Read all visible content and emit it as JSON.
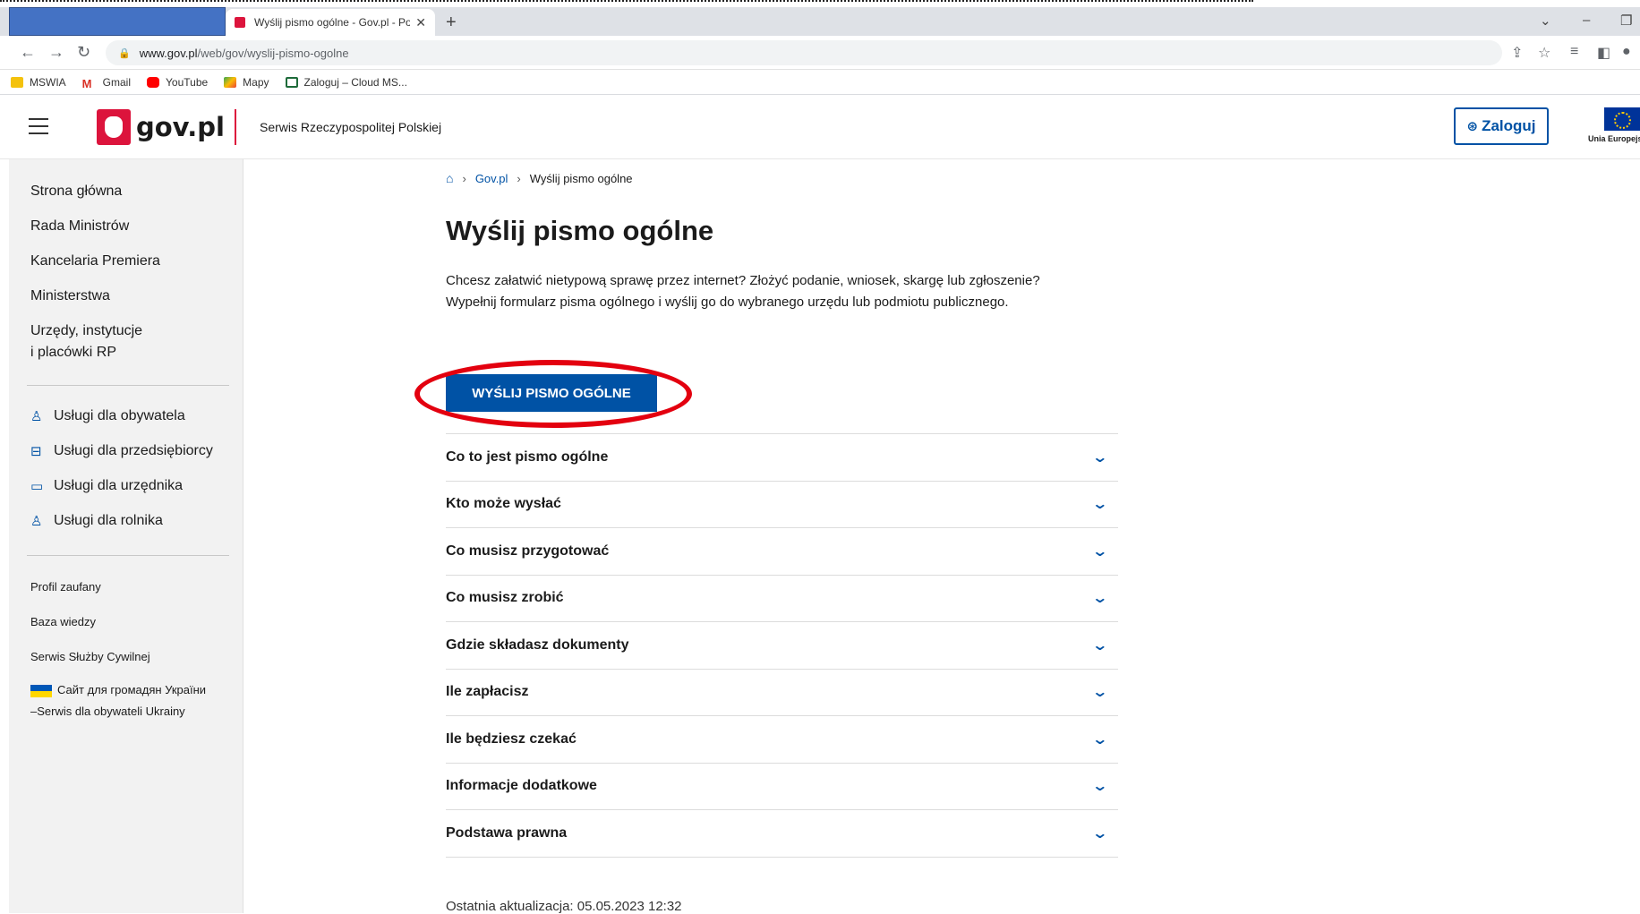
{
  "browser": {
    "tab_title": "Wyślij pismo ogólne - Gov.pl - Po",
    "url_host": "www.gov.pl",
    "url_path": "/web/gov/wyslij-pismo-ogolne",
    "bookmarks": [
      "MSWIA",
      "Gmail",
      "YouTube",
      "Mapy",
      "Zaloguj – Cloud MS..."
    ]
  },
  "header": {
    "logo_text": "gov.pl",
    "tagline": "Serwis Rzeczypospolitej Polskiej",
    "login_label": "Zaloguj",
    "eu_label": "Unia Europejska"
  },
  "sidebar": {
    "main_items": [
      "Strona główna",
      "Rada Ministrów",
      "Kancelaria Premiera",
      "Ministerstwa",
      "Urzędy, instytucje",
      "i placówki RP"
    ],
    "services": [
      "Usługi dla obywatela",
      "Usługi dla przedsiębiorcy",
      "Usługi dla urzędnika",
      "Usługi dla rolnika"
    ],
    "links": [
      "Profil zaufany",
      "Baza wiedzy",
      "Serwis Służby Cywilnej",
      "Сайт для громадян України",
      "–Serwis dla obywateli Ukrainy"
    ]
  },
  "main": {
    "breadcrumb": [
      "Gov.pl",
      "Wyślij pismo ogólne"
    ],
    "title": "Wyślij pismo ogólne",
    "intro_line1": "Chcesz załatwić nietypową sprawę przez internet? Złożyć podanie, wniosek, skargę lub zgłoszenie?",
    "intro_line2": "Wypełnij formularz pisma ogólnego i wyślij go do wybranego urzędu lub podmiotu publicznego.",
    "cta_label": "WYŚLIJ PISMO OGÓLNE",
    "accordion": [
      "Co to jest pismo ogólne",
      "Kto może wysłać",
      "Co musisz przygotować",
      "Co musisz zrobić",
      "Gdzie składasz dokumenty",
      "Ile zapłacisz",
      "Ile będziesz czekać",
      "Informacje dodatkowe",
      "Podstawa prawna"
    ],
    "updated": "Ostatnia aktualizacja: 05.05.2023 12:32"
  },
  "colors": {
    "brand_blue": "#0052a5",
    "gov_red": "#dc143c",
    "annotation_red": "#e3000f"
  }
}
